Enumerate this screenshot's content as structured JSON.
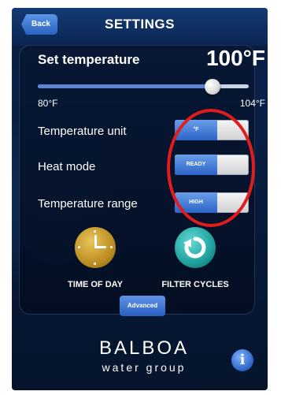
{
  "header": {
    "back_label": "Back",
    "title": "SETTINGS"
  },
  "temperature": {
    "label": "Set temperature",
    "value": "100°F",
    "min_label": "80°F",
    "max_label": "104°F",
    "setpoint_fraction": 0.83
  },
  "rows": [
    {
      "label": "Temperature unit",
      "toggle_value": "°F"
    },
    {
      "label": "Heat mode",
      "toggle_value": "READY"
    },
    {
      "label": "Temperature range",
      "toggle_value": "HIGH"
    }
  ],
  "shortcuts": {
    "time_of_day_label": "TIME OF DAY",
    "filter_cycles_label": "FILTER CYCLES"
  },
  "advanced_label": "Advanced",
  "logo": {
    "name": "BALBOA",
    "sub": "water group"
  },
  "colors": {
    "highlight": "#e01c1c",
    "accent": "#2c64c8",
    "clock": "#c9a23a",
    "filter": "#1fa19e"
  },
  "icons": [
    "back-arrow-icon",
    "clock-icon",
    "refresh-icon",
    "info-icon"
  ]
}
